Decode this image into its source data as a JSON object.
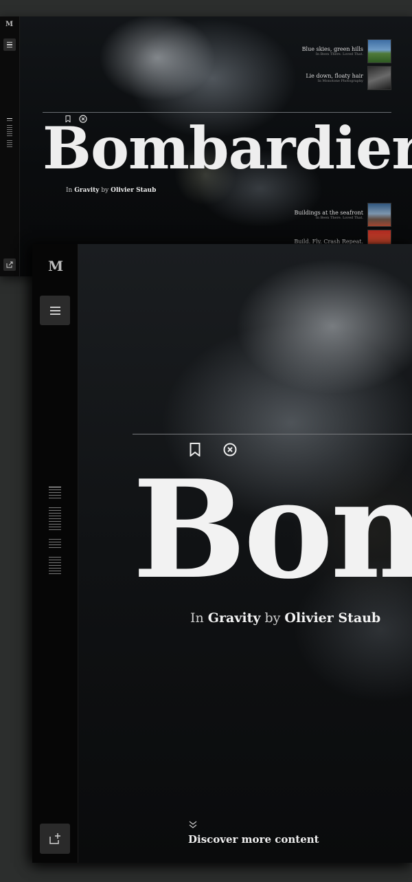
{
  "small_view": {
    "logo": "M",
    "menu_icon": "hamburger-icon",
    "share_icon": "share-icon",
    "article": {
      "title": "Bombardier",
      "byline_prefix": "In",
      "category": "Gravity",
      "byline_by": "by",
      "author": "Olivier Staub"
    },
    "related": [
      {
        "title": "Blue skies, green hills",
        "meta": "In Been There. Loved That."
      },
      {
        "title": "Lie down, floaty hair",
        "meta": "In Monotone Photography"
      },
      {
        "title": "Buildings at the seafront",
        "meta": "In Been There. Loved That."
      },
      {
        "title": "Build. Fly. Crash Repeat.",
        "meta": ""
      }
    ]
  },
  "large_view": {
    "logo": "M",
    "menu_icon": "hamburger-icon",
    "share_icon": "share-icon",
    "article": {
      "title": "Bombardier",
      "byline_prefix": "In",
      "category": "Gravity",
      "byline_by": "by",
      "author": "Olivier Staub"
    },
    "discover_label": "Discover more content"
  },
  "colors": {
    "background": "#2c2e2d",
    "window": "#040404",
    "button": "#2b2b2b",
    "text": "#f2f2f2"
  }
}
